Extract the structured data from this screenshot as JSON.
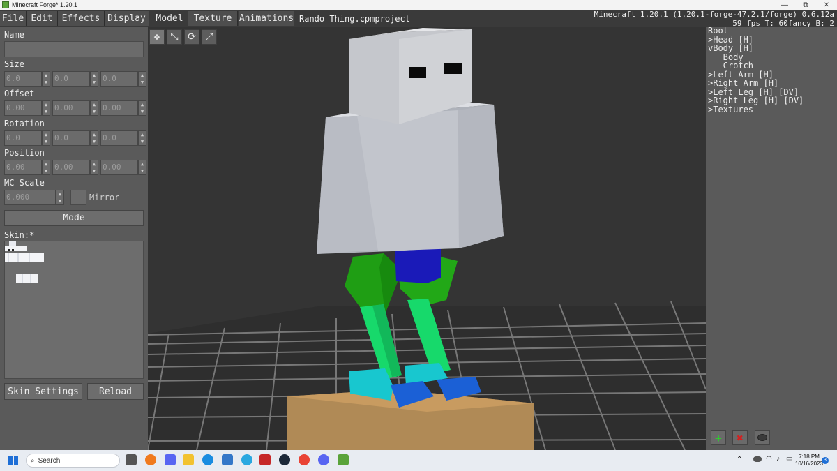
{
  "window": {
    "title": "Minecraft Forge* 1.20.1",
    "controls": [
      "—",
      "⧉",
      "✕"
    ]
  },
  "menu": {
    "items": [
      "File",
      "Edit",
      "Effects",
      "Display",
      "Model",
      "Texture",
      "Animations"
    ],
    "active": "Model",
    "project_name": "Rando Thing.cpmproject",
    "mc_info_line1": "Minecraft 1.20.1 (1.20.1-forge-47.2.1/forge) 0.6.12a",
    "mc_info_line2": "59 fps T: 60fancy B: 2"
  },
  "left_panel": {
    "name_label": "Name",
    "name_value": "",
    "size_label": "Size",
    "size_values": [
      "0.0",
      "0.0",
      "0.0"
    ],
    "offset_label": "Offset",
    "offset_values": [
      "0.00",
      "0.00",
      "0.00"
    ],
    "rotation_label": "Rotation",
    "rotation_values": [
      "0.0",
      "0.0",
      "0.0"
    ],
    "position_label": "Position",
    "position_values": [
      "0.00",
      "0.00",
      "0.00"
    ],
    "mc_scale_label": "MC Scale",
    "mc_scale_value": "0.000",
    "mirror_label": "Mirror",
    "mode_button": "Mode",
    "skin_label": "Skin:*",
    "skin_settings_button": "Skin Settings",
    "reload_button": "Reload"
  },
  "tools": [
    "move-icon",
    "scale-icon",
    "rotate-icon",
    "pivot-icon"
  ],
  "tree": {
    "items": [
      "Root",
      ">Head [H]",
      "vBody [H]",
      "   Body",
      "   Crotch",
      ">Left Arm [H]",
      ">Right Arm [H]",
      ">Left Leg [H] [DV]",
      ">Right Leg [H] [DV]",
      ">Textures"
    ]
  },
  "right_buttons": {
    "add_color": "#2ecc2e",
    "delete_color": "#d42020"
  },
  "taskbar": {
    "search_placeholder": "Search",
    "time": "7:18 PM",
    "date": "10/16/2023",
    "notification_count": "3"
  }
}
